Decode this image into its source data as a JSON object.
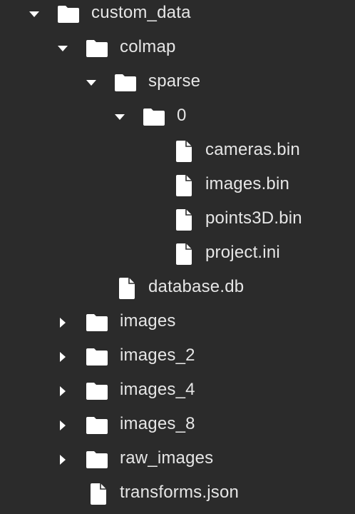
{
  "tree": {
    "items": [
      {
        "name": "custom_data",
        "type": "folder",
        "expanded": true
      },
      {
        "name": "colmap",
        "type": "folder",
        "expanded": true
      },
      {
        "name": "sparse",
        "type": "folder",
        "expanded": true
      },
      {
        "name": "0",
        "type": "folder",
        "expanded": true
      },
      {
        "name": "cameras.bin",
        "type": "file"
      },
      {
        "name": "images.bin",
        "type": "file"
      },
      {
        "name": "points3D.bin",
        "type": "file"
      },
      {
        "name": "project.ini",
        "type": "file"
      },
      {
        "name": "database.db",
        "type": "file"
      },
      {
        "name": "images",
        "type": "folder",
        "expanded": false
      },
      {
        "name": "images_2",
        "type": "folder",
        "expanded": false
      },
      {
        "name": "images_4",
        "type": "folder",
        "expanded": false
      },
      {
        "name": "images_8",
        "type": "folder",
        "expanded": false
      },
      {
        "name": "raw_images",
        "type": "folder",
        "expanded": false
      },
      {
        "name": "transforms.json",
        "type": "file"
      }
    ]
  },
  "colors": {
    "background": "#2b2b2b",
    "text": "#e6e6e6",
    "icon": "#ffffff"
  },
  "icons": {
    "folder": "folder-icon",
    "file": "file-icon",
    "expanded": "caret-down-icon",
    "collapsed": "caret-right-icon"
  }
}
